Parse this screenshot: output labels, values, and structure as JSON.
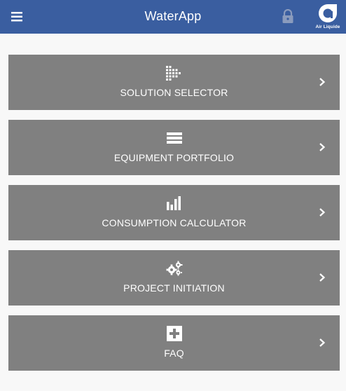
{
  "app": {
    "title": "WaterApp",
    "logo_text": "Air Liquide",
    "header_color": "#3a5ea0",
    "card_color": "#808080",
    "background_color": "#f8f8f8"
  },
  "header": {
    "menu_icon": "hamburger-menu-icon",
    "lock_icon": "lock-icon",
    "logo_icon": "air-liquide-logo-icon"
  },
  "menu": {
    "items": [
      {
        "label": "SOLUTION SELECTOR",
        "icon": "funnel-selector-icon"
      },
      {
        "label": "EQUIPMENT PORTFOLIO",
        "icon": "stacked-bars-icon"
      },
      {
        "label": "CONSUMPTION CALCULATOR",
        "icon": "bar-chart-icon"
      },
      {
        "label": "PROJECT INITIATION",
        "icon": "gears-icon"
      },
      {
        "label": "FAQ",
        "icon": "first-aid-cross-icon"
      }
    ],
    "chevron_icon": "chevron-right-icon"
  }
}
